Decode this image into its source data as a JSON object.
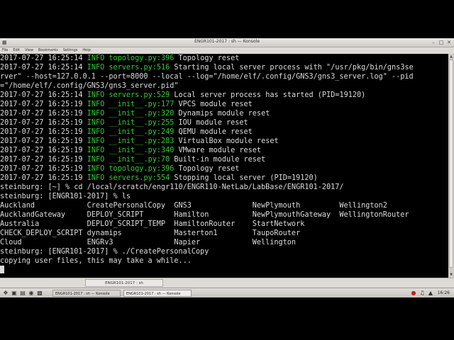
{
  "window": {
    "title": "ENGR101-2017 : sh — Konsole"
  },
  "menu": {
    "items": [
      "File",
      "Edit",
      "View",
      "Bookmarks",
      "Settings",
      "Help"
    ]
  },
  "terminal": {
    "lines": [
      {
        "ts": "2017-07-27 16:25:14",
        "lvl": "INFO",
        "src": "topology.py:396",
        "msg": "Topology reset"
      },
      {
        "ts": "2017-07-27 16:25:14",
        "lvl": "INFO",
        "src": "servers.py:516",
        "msg": "Starting local server process with \"/usr/pkg/bin/gns3se"
      },
      {
        "text": "rver\" --host=127.0.0.1 --port=8000 --local --log=\"/home/elf/.config/GNS3/gns3_server.log\" --pid"
      },
      {
        "text": "=\"/home/elf/.config/GNS3/gns3_server.pid\""
      },
      {
        "ts": "2017-07-27 16:25:14",
        "lvl": "INFO",
        "src": "servers.py:529",
        "msg": "Local server process has started (PID=19120)"
      },
      {
        "ts": "2017-07-27 16:25:19",
        "lvl": "INFO",
        "src": "__init__.py:177",
        "msg": "VPCS module reset"
      },
      {
        "ts": "2017-07-27 16:25:19",
        "lvl": "INFO",
        "src": "__init__.py:320",
        "msg": "Dynamips module reset"
      },
      {
        "ts": "2017-07-27 16:25:19",
        "lvl": "INFO",
        "src": "__init__.py:255",
        "msg": "IOU module reset"
      },
      {
        "ts": "2017-07-27 16:25:19",
        "lvl": "INFO",
        "src": "__init__.py:249",
        "msg": "QEMU module reset"
      },
      {
        "ts": "2017-07-27 16:25:19",
        "lvl": "INFO",
        "src": "__init__.py:283",
        "msg": "VirtualBox module reset"
      },
      {
        "ts": "2017-07-27 16:25:19",
        "lvl": "INFO",
        "src": "__init__.py:340",
        "msg": "VMware module reset"
      },
      {
        "ts": "2017-07-27 16:25:19",
        "lvl": "INFO",
        "src": "__init__.py:70",
        "msg": "Built-in module reset"
      },
      {
        "ts": "2017-07-27 16:25:19",
        "lvl": "INFO",
        "src": "topology.py:396",
        "msg": "Topology reset"
      },
      {
        "ts": "2017-07-27 16:25:19",
        "lvl": "INFO",
        "src": "servers.py:554",
        "msg": "Stopping local server (PID=19120)"
      },
      {
        "text": "steinburg: [~] % cd /local/scratch/engr110/ENGR110-NetLab/LabBase/ENGR101-2017/"
      },
      {
        "text": "steinburg: [ENGR101-2017] % ls"
      },
      {
        "text": "Auckland            CreatePersonalCopy  GNS3              NewPlymouth         Wellington2"
      },
      {
        "text": "AucklandGateway     DEPLOY_SCRIPT       Hamilton          NewPlymouthGateway  WellingtonRouter"
      },
      {
        "text": "Australia           DEPLOY_SCRIPT_TEMP  HamiltonRouter    StartNetwork"
      },
      {
        "text": "CHECK_DEPLOY_SCRIPT dynamips            Masterton1        TaupoRouter"
      },
      {
        "text": "Cloud               ENGRv3              Napier            Wellington"
      },
      {
        "text": "steinburg: [ENGR101-2017] % ./CreatePersonalCopy"
      },
      {
        "text": "copying user files, this may take a while..."
      }
    ]
  },
  "tab": {
    "label": "ENGR101-2017 : sh"
  },
  "taskbar": {
    "tasks": [
      "ENGR101-2017 : sh — Konsole",
      "ENGR101-2017 : sh — Konsole"
    ],
    "clock": "16:26"
  },
  "colors": {
    "terminal_bg": "#000000",
    "terminal_fg": "#dcdcdc",
    "log_accent": "#37c837"
  }
}
